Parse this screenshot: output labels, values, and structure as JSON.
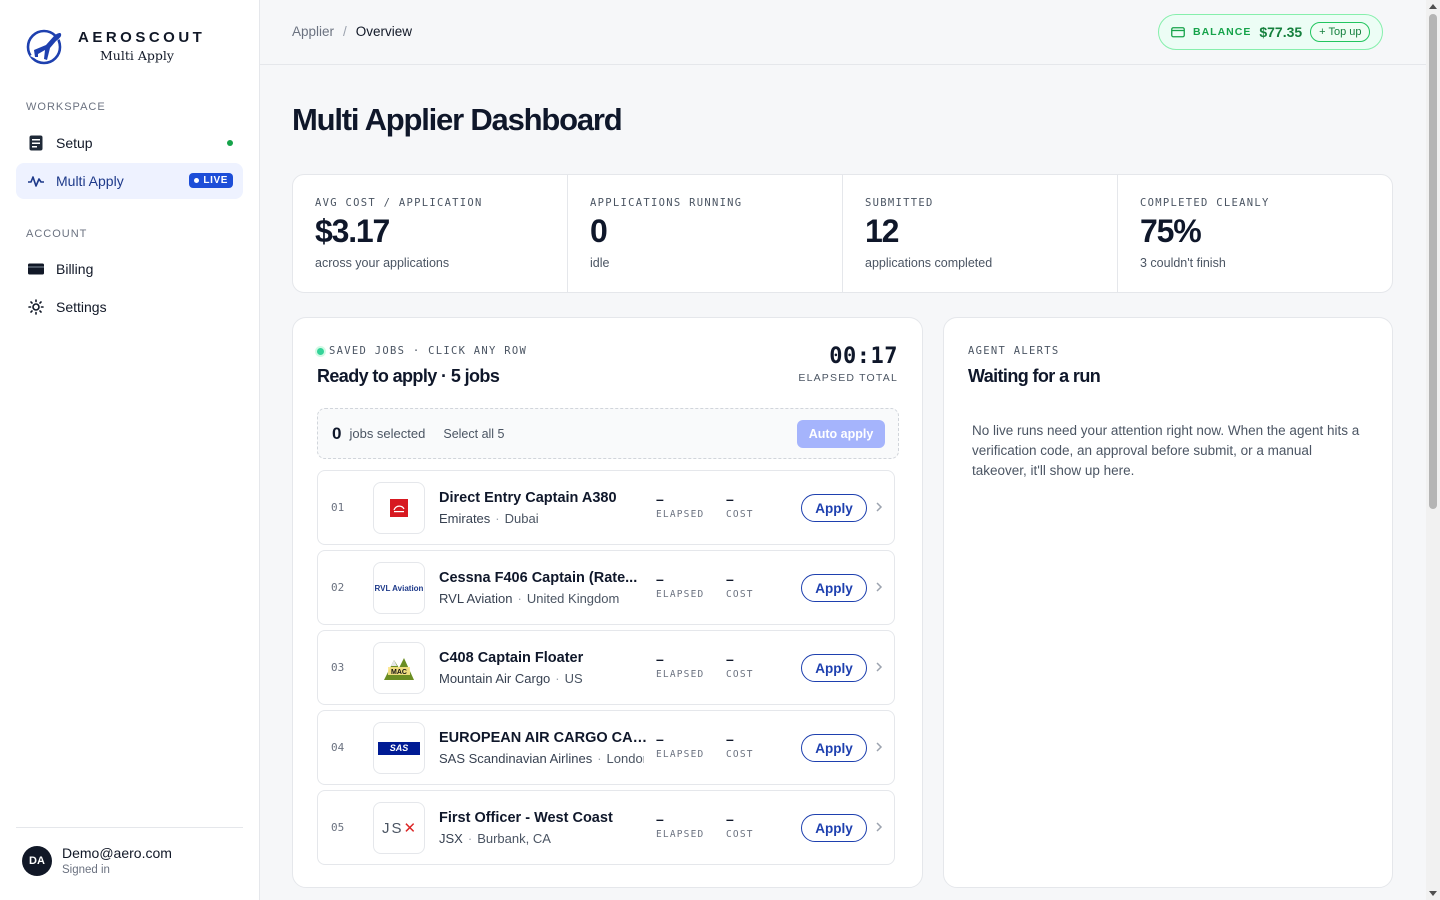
{
  "app": {
    "brand_name": "AEROSCOUT",
    "brand_sub": "Multi Apply"
  },
  "sidebar": {
    "workspace_label": "WORKSPACE",
    "account_label": "ACCOUNT",
    "items": [
      {
        "label": "Setup",
        "icon": "clipboard-icon",
        "status": "green-dot"
      },
      {
        "label": "Multi Apply",
        "icon": "activity-icon",
        "badge": "LIVE",
        "active": true
      },
      {
        "label": "Billing",
        "icon": "credit-card-icon"
      },
      {
        "label": "Settings",
        "icon": "gear-icon"
      }
    ],
    "user": {
      "initials": "DA",
      "email": "Demo@aero.com",
      "status": "Signed in"
    }
  },
  "header": {
    "breadcrumb": [
      "Applier",
      "Overview"
    ],
    "balance_label": "BALANCE",
    "balance_value": "$77.35",
    "topup_label": "+ Top up"
  },
  "main": {
    "title": "Multi Applier Dashboard",
    "stats": [
      {
        "label": "AVG COST / APPLICATION",
        "value": "$3.17",
        "sub": "across your applications"
      },
      {
        "label": "APPLICATIONS RUNNING",
        "value": "0",
        "sub": "idle"
      },
      {
        "label": "SUBMITTED",
        "value": "12",
        "sub": "applications completed"
      },
      {
        "label": "COMPLETED CLEANLY",
        "value": "75%",
        "sub": "3 couldn't finish"
      }
    ]
  },
  "jobs": {
    "eyebrow": "SAVED JOBS · CLICK ANY ROW",
    "title": "Ready to apply · 5 jobs",
    "timer_value": "00:17",
    "timer_label": "ELAPSED TOTAL",
    "selected_count": "0",
    "selected_text": "jobs selected",
    "select_all": "Select all 5",
    "auto_apply": "Auto apply",
    "elapsed_label": "ELAPSED",
    "cost_label": "COST",
    "apply_label": "Apply",
    "rows": [
      {
        "num": "01",
        "title": "Direct Entry Captain A380",
        "company": "Emirates",
        "location": "Dubai",
        "elapsed": "–",
        "cost": "–",
        "logo": "emirates-logo"
      },
      {
        "num": "02",
        "title": "Cessna F406 Captain (Rate...",
        "company": "RVL Aviation",
        "location": "United Kingdom",
        "elapsed": "–",
        "cost": "–",
        "logo": "rvl-aviation-logo",
        "logo_text": "RVL Aviation"
      },
      {
        "num": "03",
        "title": "C408 Captain Floater",
        "company": "Mountain Air Cargo",
        "location": "US",
        "elapsed": "–",
        "cost": "–",
        "logo": "mountain-air-cargo-logo",
        "logo_text": "MAC"
      },
      {
        "num": "04",
        "title": "EUROPEAN AIR CARGO CAP...",
        "company": "SAS Scandinavian Airlines",
        "location": "London",
        "elapsed": "–",
        "cost": "–",
        "logo": "sas-logo",
        "logo_text": "SAS"
      },
      {
        "num": "05",
        "title": "First Officer - West Coast",
        "company": "JSX",
        "location": "Burbank, CA",
        "elapsed": "–",
        "cost": "–",
        "logo": "jsx-logo",
        "logo_text": "JSX"
      }
    ]
  },
  "alerts": {
    "eyebrow": "AGENT ALERTS",
    "title": "Waiting for a run",
    "body": "No live runs need your attention right now. When the agent hits a verification code, an approval before submit, or a manual takeover, it'll show up here."
  },
  "colors": {
    "accent": "#1d4ed8",
    "success": "#16a34a",
    "auto_apply_disabled": "#a5b4fc",
    "balance_bg": "#ecfdf5"
  }
}
